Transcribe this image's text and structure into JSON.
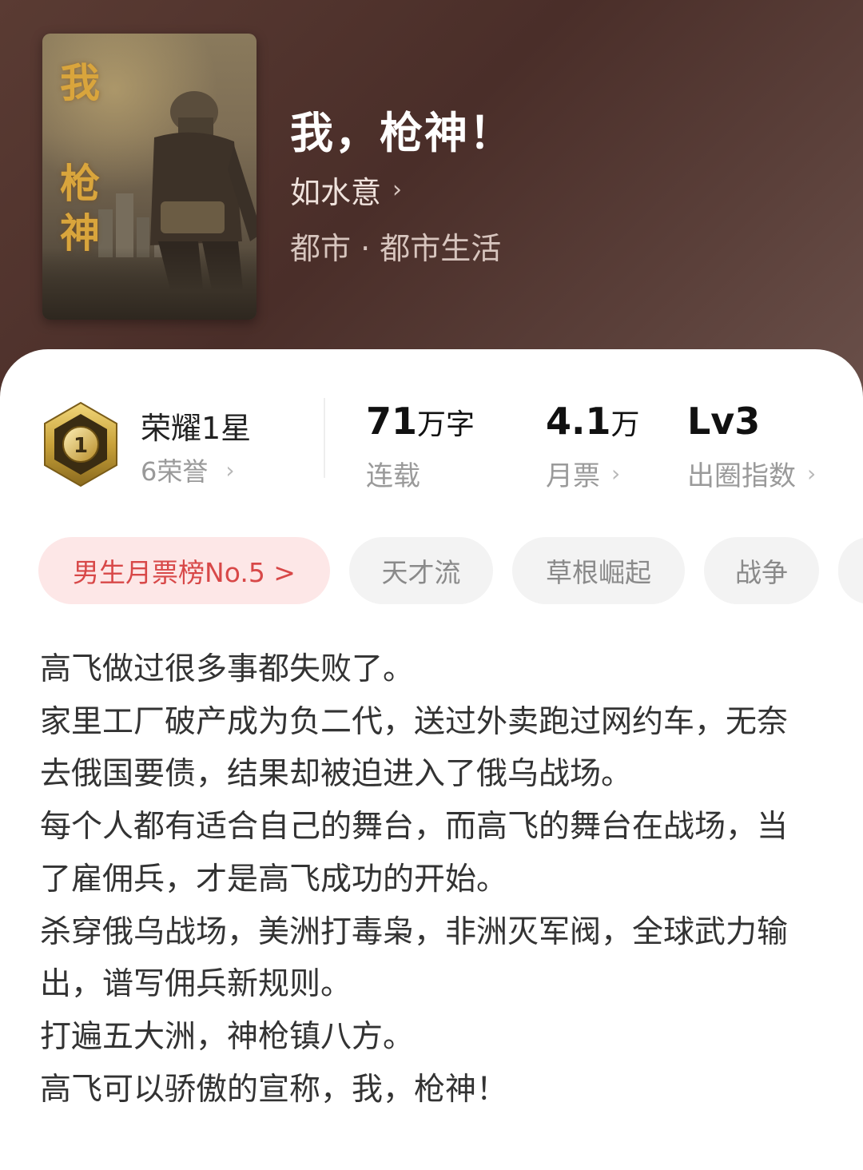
{
  "book": {
    "cover_title_1": "我",
    "cover_title_2": "枪",
    "cover_title_3": "神",
    "title": "我，枪神！",
    "author": "如水意",
    "author_chevron": "›",
    "genre": "都市 · 都市生活"
  },
  "stats": {
    "honor": {
      "title": "荣耀1星",
      "sub": "6荣誉",
      "badge_number": "1"
    },
    "words": {
      "value": "71",
      "unit": "万字",
      "label": "连载"
    },
    "votes": {
      "value": "4.1",
      "unit": "万",
      "label": "月票"
    },
    "index": {
      "value": "Lv3",
      "label": "出圈指数"
    },
    "chevron": "›"
  },
  "tags": [
    {
      "label": "男生月票榜No.5 >"
    },
    {
      "label": "天才流"
    },
    {
      "label": "草根崛起"
    },
    {
      "label": "战争"
    }
  ],
  "synopsis": [
    "高飞做过很多事都失败了。",
    "家里工厂破产成为负二代，送过外卖跑过网约车，无奈去俄国要债，结果却被迫进入了俄乌战场。",
    "每个人都有适合自己的舞台，而高飞的舞台在战场，当了雇佣兵，才是高飞成功的开始。",
    "杀穿俄乌战场，美洲打毒枭，非洲灭军阀，全球武力输出，谱写佣兵新规则。",
    "打遍五大洲，神枪镇八方。",
    "高飞可以骄傲的宣称，我，枪神！"
  ],
  "colors": {
    "hero_bg": "#4a2e29",
    "rank_tag_bg": "#fde7e7",
    "rank_tag_text": "#d84848",
    "badge_gold": "#c9a23a"
  }
}
